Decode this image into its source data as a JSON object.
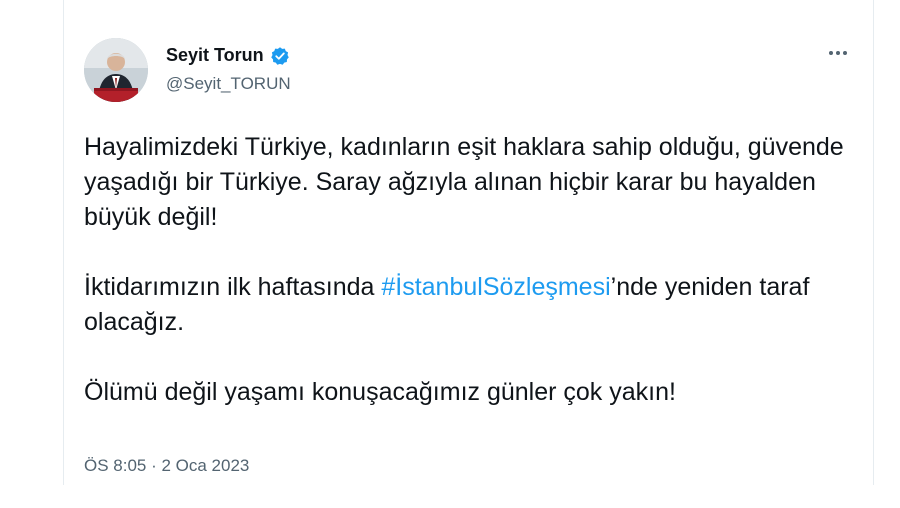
{
  "tweet": {
    "author": {
      "display_name": "Seyit Torun",
      "handle": "@Seyit_TORUN",
      "verified": true,
      "avatar": "profile-photo"
    },
    "more_icon": "more-horizontal-icon",
    "paragraphs": [
      "Hayalimizdeki Türkiye, kadınların eşit haklara sahip olduğu, güvende yaşadığı bir Türkiye. Saray ağzıyla alınan hiçbir karar bu hayalden büyük değil!",
      "İktidarımızın ilk haftasında ",
      "#İstanbulSözleşmesi",
      "’nde yeniden taraf olacağız.",
      "Ölümü değil yaşamı konuşacağımız günler çok yakın!"
    ],
    "timestamp": "ÖS 8:05 · 2 Oca 2023"
  },
  "colors": {
    "text": "#0f1419",
    "secondary": "#536471",
    "link": "#1d9bf0",
    "verified_badge": "#1d9bf0"
  }
}
